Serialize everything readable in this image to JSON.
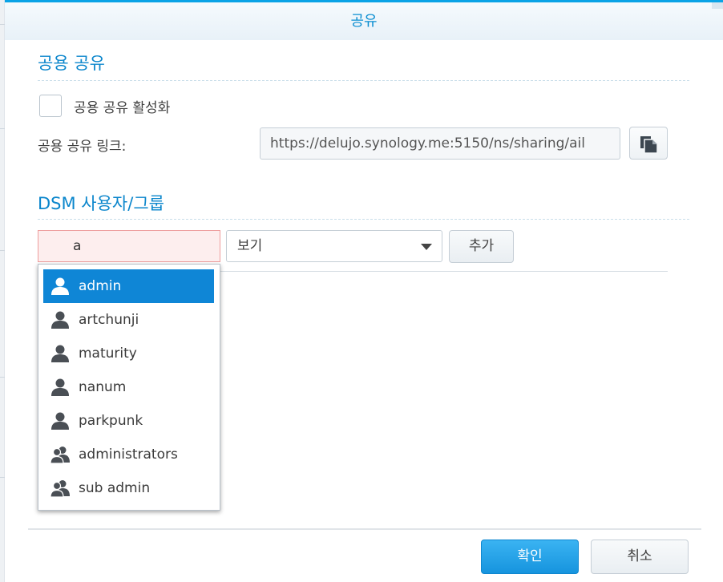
{
  "dialog": {
    "title": "공유"
  },
  "public_share": {
    "section_title": "공용 공유",
    "enable_label": "공용 공유 활성화",
    "enabled": false,
    "link_label": "공용 공유 링크:",
    "link_value": "https://delujo.synology.me:5150/ns/sharing/ail"
  },
  "dsm_users": {
    "section_title": "DSM 사용자/그룹",
    "search_value": "a",
    "permission_select": "보기",
    "add_label": "추가",
    "suggestions": [
      {
        "name": "admin",
        "type": "user",
        "icon": "user-icon",
        "selected": true
      },
      {
        "name": "artchunji",
        "type": "user",
        "icon": "user-icon",
        "selected": false
      },
      {
        "name": "maturity",
        "type": "user",
        "icon": "user-icon",
        "selected": false
      },
      {
        "name": "nanum",
        "type": "user",
        "icon": "user-icon",
        "selected": false
      },
      {
        "name": "parkpunk",
        "type": "user",
        "icon": "user-icon",
        "selected": false
      },
      {
        "name": "administrators",
        "type": "group",
        "icon": "group-icon",
        "selected": false
      },
      {
        "name": "sub admin",
        "type": "group",
        "icon": "group-icon",
        "selected": false
      }
    ]
  },
  "footer": {
    "ok_label": "확인",
    "cancel_label": "취소"
  },
  "colors": {
    "accent": "#0b86cc",
    "selected": "#0f86d6",
    "error_bg": "#fdeeee"
  }
}
